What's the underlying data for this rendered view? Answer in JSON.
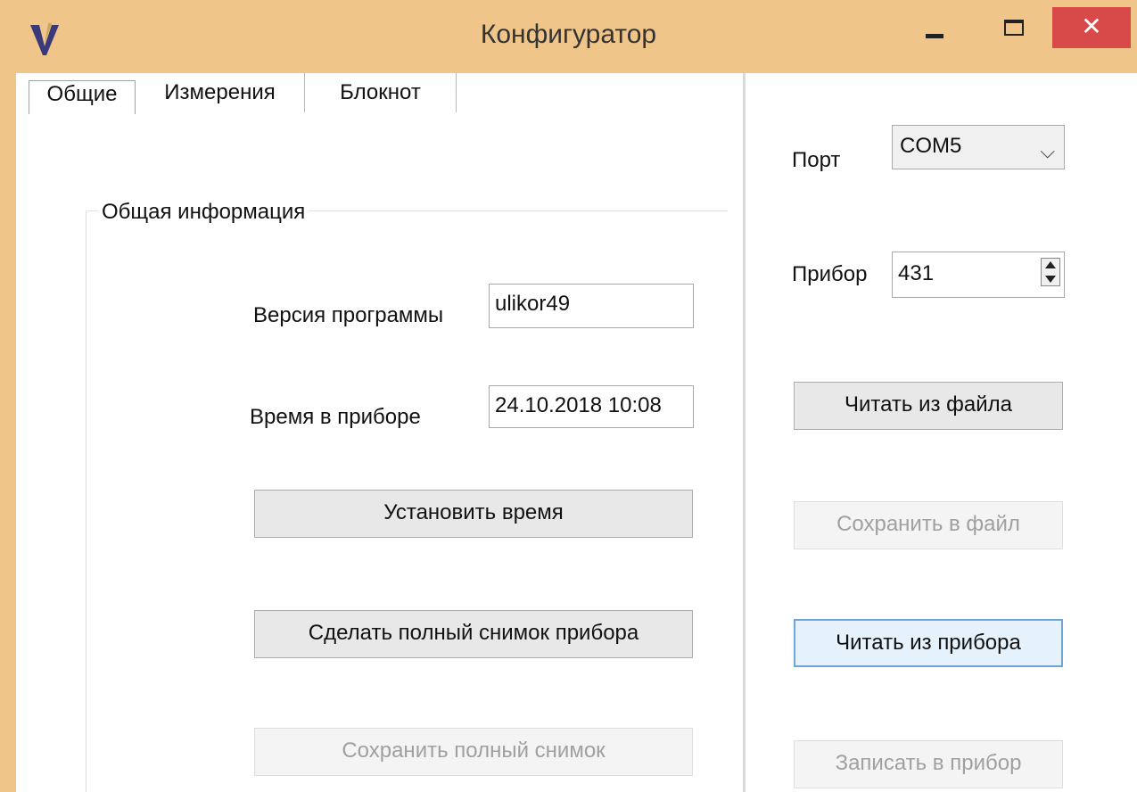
{
  "window": {
    "title": "Конфигуратор",
    "close_glyph": "✕",
    "app_icon": "app-logo-icon",
    "controls": [
      "minimize-icon",
      "maximize-icon",
      "close-icon"
    ]
  },
  "tabs": [
    {
      "label": "Общие",
      "active": true
    },
    {
      "label": "Измерения",
      "active": false
    },
    {
      "label": "Блокнот",
      "active": false
    }
  ],
  "general": {
    "group_title": "Общая информация",
    "version_label": "Версия программы",
    "version_value": "ulikor49",
    "time_label": "Время в приборе",
    "time_value": "24.10.2018  10:08",
    "set_time_button": "Установить время",
    "snapshot_button": "Сделать полный снимок прибора",
    "save_snapshot_button": "Сохранить полный снимок"
  },
  "connection": {
    "port_label": "Порт",
    "port_value": "COM5",
    "device_label": "Прибор",
    "device_value": "431",
    "read_file_button": "Читать из файла",
    "save_file_button": "Сохранить в файл",
    "read_device_button": "Читать из прибора",
    "write_device_button": "Записать в прибор"
  },
  "colors": {
    "titlebar": "#f0c58a",
    "close": "#d8494a",
    "focus_border": "#6fa4d6"
  }
}
